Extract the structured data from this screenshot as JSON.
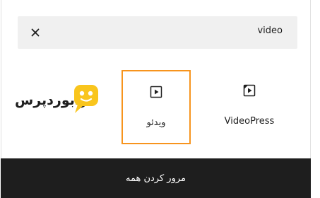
{
  "search": {
    "value": "video"
  },
  "icons": {
    "close": "close-icon",
    "video": "play-icon",
    "videopress": "videopress-icon"
  },
  "blocks": [
    {
      "label": "ویدئو",
      "icon": "play-icon",
      "selected": true
    },
    {
      "label": "VideoPress",
      "icon": "videopress-icon",
      "selected": false
    }
  ],
  "logo": {
    "text": "رابوردپرس"
  },
  "footer": {
    "label": "مرور کردن همه"
  },
  "colors": {
    "highlight": "#f7941d",
    "footer_bg": "#1e1e1e",
    "search_bg": "#f0f0f0",
    "logo_yellow": "#f9c51d"
  }
}
